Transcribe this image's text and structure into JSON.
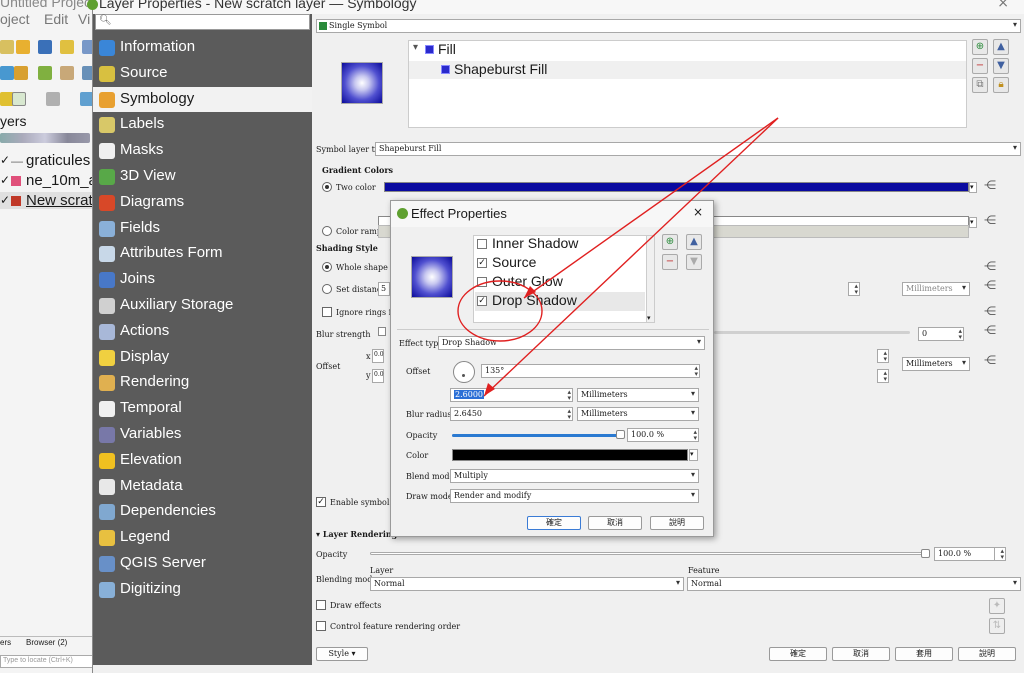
{
  "main_window": {
    "menu_project": "oject",
    "menu_edit": "Edit",
    "menu_view": "Vi",
    "title_partial": "Untitled Projec",
    "layers_label": "yers",
    "layers": [
      {
        "name": "graticules",
        "color": "#ffffff",
        "checked": true
      },
      {
        "name": "ne_10m_a",
        "color": "#e0507a",
        "checked": true
      },
      {
        "name": "New scrat",
        "color": "#c03828",
        "checked": true
      }
    ],
    "bottom_tabs": [
      "ers",
      "Browser (2)"
    ],
    "locate_placeholder": "Type to locate (Ctrl+K)"
  },
  "dialog": {
    "title": "Layer Properties - New scratch layer — Symbology",
    "close": "×",
    "search_placeholder": "",
    "sidebar": [
      {
        "label": "Information",
        "icon": "information-icon",
        "color": "#3a86d8"
      },
      {
        "label": "Source",
        "icon": "source-icon",
        "color": "#d8c040"
      },
      {
        "label": "Symbology",
        "icon": "symbology-icon",
        "color": "#e8a030",
        "selected": true
      },
      {
        "label": "Labels",
        "icon": "labels-icon",
        "color": "#d8c868"
      },
      {
        "label": "Masks",
        "icon": "masks-icon",
        "color": "#f0f0f0"
      },
      {
        "label": "3D View",
        "icon": "3d-view-icon",
        "color": "#58a848"
      },
      {
        "label": "Diagrams",
        "icon": "diagrams-icon",
        "color": "#d84828"
      },
      {
        "label": "Fields",
        "icon": "fields-icon",
        "color": "#8ab0d8"
      },
      {
        "label": "Attributes Form",
        "icon": "attributes-form-icon",
        "color": "#c8d8e8"
      },
      {
        "label": "Joins",
        "icon": "joins-icon",
        "color": "#4878c8"
      },
      {
        "label": "Auxiliary Storage",
        "icon": "auxiliary-storage-icon",
        "color": "#d0d0d0"
      },
      {
        "label": "Actions",
        "icon": "actions-icon",
        "color": "#a8b8d8"
      },
      {
        "label": "Display",
        "icon": "display-icon",
        "color": "#f0d040"
      },
      {
        "label": "Rendering",
        "icon": "rendering-icon",
        "color": "#e0b050"
      },
      {
        "label": "Temporal",
        "icon": "temporal-icon",
        "color": "#f0f0f0"
      },
      {
        "label": "Variables",
        "icon": "variables-icon",
        "color": "#7878a8"
      },
      {
        "label": "Elevation",
        "icon": "elevation-icon",
        "color": "#f0c020"
      },
      {
        "label": "Metadata",
        "icon": "metadata-icon",
        "color": "#e8e8e8"
      },
      {
        "label": "Dependencies",
        "icon": "dependencies-icon",
        "color": "#80a8d0"
      },
      {
        "label": "Legend",
        "icon": "legend-icon",
        "color": "#e8c040"
      },
      {
        "label": "QGIS Server",
        "icon": "qgis-server-icon",
        "color": "#6890c8"
      },
      {
        "label": "Digitizing",
        "icon": "digitizing-icon",
        "color": "#88b0d8"
      }
    ],
    "symbol_mode": "Single Symbol",
    "tree": {
      "fill": "Fill",
      "shapeburst": "Shapeburst Fill"
    },
    "symbol_layer_type_label": "Symbol layer type",
    "symbol_layer_type": "Shapeburst Fill",
    "gradient_colors": "Gradient Colors",
    "two_color": "Two color",
    "color_ramp": "Color ramp",
    "shading_style": "Shading Style",
    "whole_shape": "Whole shape",
    "set_distance": "Set distance",
    "set_distance_value": "5",
    "ignore_rings": "Ignore rings in po",
    "blur_strength": "Blur strength",
    "blur_value": "0",
    "offset": "Offset",
    "offset_x": "x",
    "offset_y": "y",
    "offset_x_value": "0.0",
    "offset_y_value": "0.0",
    "units_millimeters": "Millimeters",
    "enable_symbol_layer": "Enable symbol laye",
    "layer_rendering": "Layer Rendering",
    "opacity": "Opacity",
    "opacity_value": "100.0 %",
    "opacity_level": 1.0,
    "layer_col": "Layer",
    "feature_col": "Feature",
    "blending_mode": "Blending mode",
    "blend_layer": "Normal",
    "blend_feature": "Normal",
    "draw_effects": "Draw effects",
    "control_order": "Control feature rendering order",
    "style_btn": "Style",
    "ok": "確定",
    "cancel": "取消",
    "apply": "套用",
    "help": "說明",
    "color1": "#0a0aa0",
    "color2": "#ffffff"
  },
  "effects": {
    "title": "Effect Properties",
    "close": "×",
    "list": [
      {
        "name": "Inner Shadow",
        "checked": false
      },
      {
        "name": "Source",
        "checked": true
      },
      {
        "name": "Outer Glow",
        "checked": false
      },
      {
        "name": "Drop Shadow",
        "checked": true,
        "selected": true
      }
    ],
    "effect_type_label": "Effect type",
    "effect_type": "Drop Shadow",
    "offset_label": "Offset",
    "offset_angle": "135°",
    "offset_distance": "2.6000",
    "units": "Millimeters",
    "blur_radius_label": "Blur radius",
    "blur_radius": "2.6450",
    "opacity_label": "Opacity",
    "opacity_value": "100.0 %",
    "opacity_level": 1.0,
    "color_label": "Color",
    "shadow_color": "#000000",
    "blend_mode_label": "Blend mode",
    "blend_mode": "Multiply",
    "draw_mode_label": "Draw mode",
    "draw_mode": "Render and modify",
    "ok": "確定",
    "cancel": "取消",
    "help": "說明"
  },
  "annotation_color": "#e02020"
}
